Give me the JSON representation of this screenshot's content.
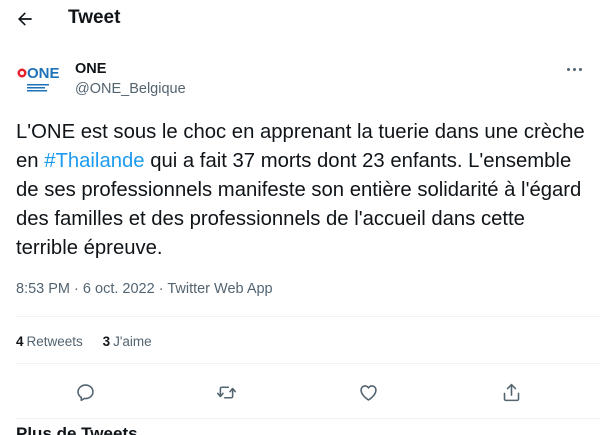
{
  "header": {
    "title": "Tweet"
  },
  "author": {
    "name": "ONE",
    "handle": "@ONE_Belgique",
    "logo_text": "ONE"
  },
  "tweet": {
    "text_part1": "L'ONE est sous le choc en apprenant la tuerie dans une crèche en ",
    "hashtag": "#Thailande",
    "text_part2": " qui a fait 37 morts dont 23 enfants. L'ensemble de ses professionnels manifeste son entière solidarité à l'égard des familles et des professionnels de l'accueil dans cette terrible épreuve."
  },
  "meta": {
    "time": "8:53 PM",
    "separator": "·",
    "date": "6 oct. 2022",
    "source": "Twitter Web App"
  },
  "stats": {
    "retweets_count": "4",
    "retweets_label": "Retweets",
    "likes_count": "3",
    "likes_label": "J'aime"
  },
  "actions": [
    "reply-icon",
    "retweet-icon",
    "like-icon",
    "share-icon"
  ],
  "footer": {
    "partial_text": "Plus de Tweets"
  },
  "colors": {
    "accent": "#1d9bf0",
    "text": "#0f1419",
    "secondary": "#536471",
    "divider": "#eff3f4",
    "logo_red": "#e8202e",
    "logo_blue": "#1e72b8"
  }
}
